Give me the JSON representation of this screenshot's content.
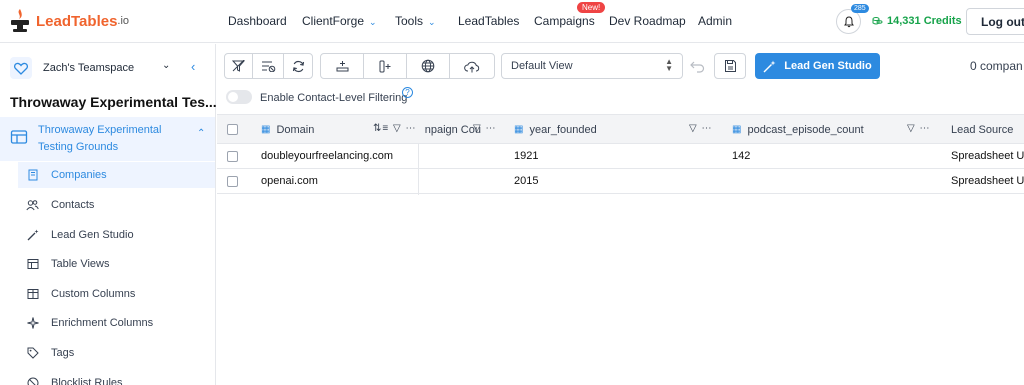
{
  "app": {
    "logo_text": "LeadTables",
    "logo_suffix": ".io",
    "nav": [
      "Dashboard",
      "ClientForge",
      "Tools",
      "LeadTables",
      "Campaigns",
      "Dev Roadmap",
      "Admin"
    ],
    "new_badge": "New!",
    "notification_count": "285",
    "credits": "14,331 Credits",
    "logout": "Log out",
    "colors": {
      "brand": "#f0642e",
      "accent": "#2d8ae0",
      "credits": "#16a34a",
      "badge": "#ef4444"
    }
  },
  "sidebar": {
    "team": "Zach's Teamspace",
    "workspace_title": "Throwaway Experimental Tes...",
    "workspace_item": "Throwaway Experimental Testing Grounds",
    "items": [
      {
        "label": "Companies",
        "icon": "building-icon",
        "active": true
      },
      {
        "label": "Contacts",
        "icon": "users-icon"
      },
      {
        "label": "Lead Gen Studio",
        "icon": "wand-icon"
      },
      {
        "label": "Table Views",
        "icon": "table-icon"
      },
      {
        "label": "Custom Columns",
        "icon": "columns-icon"
      },
      {
        "label": "Enrichment Columns",
        "icon": "sparkle-icon"
      },
      {
        "label": "Tags",
        "icon": "tag-icon"
      },
      {
        "label": "Blocklist Rules",
        "icon": "block-icon"
      }
    ]
  },
  "toolbar": {
    "view": "Default View",
    "lead_gen_button": "Lead Gen Studio",
    "company_count": "0 compan",
    "filter_toggle_label": "Enable Contact-Level Filtering"
  },
  "table": {
    "headers": [
      "Domain",
      "npaign Cou",
      "year_founded",
      "podcast_episode_count",
      "Lead Source"
    ],
    "rows": [
      [
        "doubleyourfreelancing.com",
        "",
        "1921",
        "142",
        "Spreadsheet Up"
      ],
      [
        "openai.com",
        "",
        "2015",
        "",
        "Spreadsheet Up"
      ]
    ]
  }
}
